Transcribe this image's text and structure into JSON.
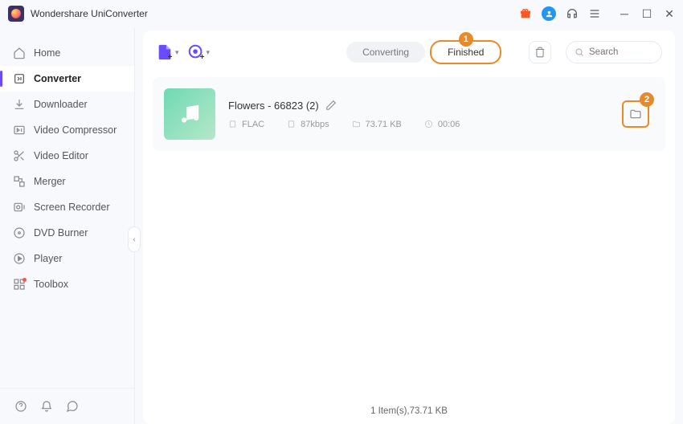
{
  "app": {
    "title": "Wondershare UniConverter"
  },
  "sidebar": {
    "items": [
      {
        "label": "Home",
        "icon": "home"
      },
      {
        "label": "Converter",
        "icon": "convert",
        "active": true
      },
      {
        "label": "Downloader",
        "icon": "download"
      },
      {
        "label": "Video Compressor",
        "icon": "compress"
      },
      {
        "label": "Video Editor",
        "icon": "scissors"
      },
      {
        "label": "Merger",
        "icon": "merge"
      },
      {
        "label": "Screen Recorder",
        "icon": "record"
      },
      {
        "label": "DVD Burner",
        "icon": "disc"
      },
      {
        "label": "Player",
        "icon": "play"
      },
      {
        "label": "Toolbox",
        "icon": "grid"
      }
    ]
  },
  "toolbar": {
    "tabs": {
      "converting": "Converting",
      "finished": "Finished"
    },
    "search_placeholder": "Search"
  },
  "callouts": {
    "tab": "1",
    "folder": "2"
  },
  "file": {
    "name": "Flowers - 66823 (2)",
    "format": "FLAC",
    "bitrate": "87kbps",
    "size": "73.71 KB",
    "duration": "00:06"
  },
  "status": {
    "summary": "1 Item(s),73.71 KB"
  }
}
